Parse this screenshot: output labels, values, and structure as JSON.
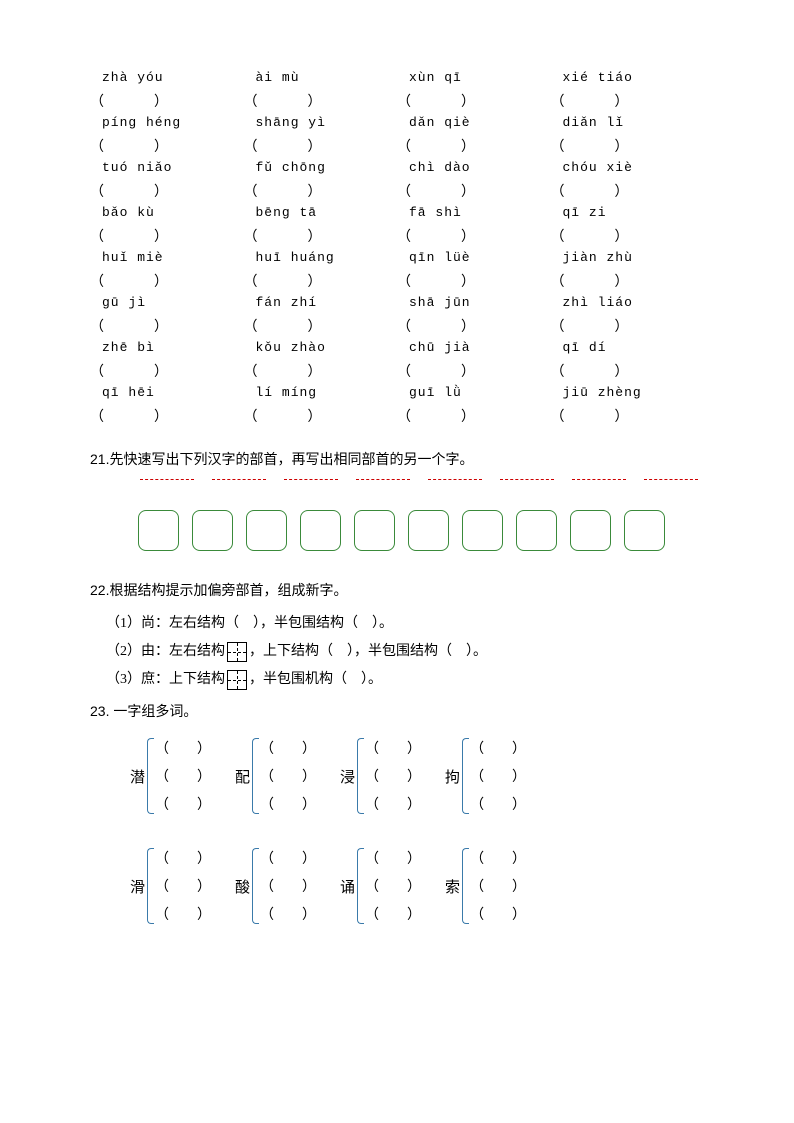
{
  "pinyin_rows": [
    [
      "zhà yóu",
      "ài mù",
      "xùn qī",
      "xié tiáo"
    ],
    [
      "píng héng",
      "shāng yì",
      "dǎn qiè",
      "diǎn lǐ"
    ],
    [
      "tuó niǎo",
      "fǔ chōng",
      "chì dào",
      "chóu xiè"
    ],
    [
      "bǎo kù",
      "bēng tā",
      "fā shì",
      "qī zi"
    ],
    [
      "huǐ miè",
      "huī huáng",
      "qīn lüè",
      "jiàn zhù"
    ],
    [
      "gū jì",
      "fán zhí",
      "shā jūn",
      "zhì liáo"
    ],
    [
      "zhē bì",
      "kǒu zhào",
      "chū jià",
      "qī dí"
    ],
    [
      "qī hēi",
      "lí míng",
      "guī lǜ",
      "jiū zhèng"
    ]
  ],
  "paren": "（　　　）",
  "q21": "先快速写出下列汉字的部首，再写出相同部首的另一个字。",
  "q22": {
    "title": "根据结构提示加偏旁部首，组成新字。",
    "i1": "（1）尚：左右结构（　），半包围结构（　）。",
    "i2a": "（2）由：左右结构",
    "i2b": "，上下结构（　），半包围结构（　）。",
    "i3a": "（3）庶：上下结构",
    "i3b": "，半包围机构（　）。"
  },
  "q23": {
    "title": "一字组多词。",
    "row1": [
      "潜",
      "配",
      "浸",
      "拘"
    ],
    "row2": [
      "滑",
      "酸",
      "诵",
      "索"
    ]
  },
  "par3": "（　　）"
}
